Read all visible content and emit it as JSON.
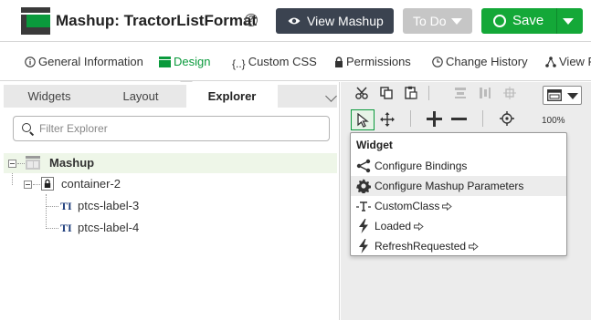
{
  "app": {
    "title": "Mashup: TractorListFormat"
  },
  "header": {
    "view_button": "View Mashup",
    "state_button": "To Do",
    "save_button": "Save"
  },
  "tabs": [
    {
      "label": "General Information"
    },
    {
      "label": "Design",
      "active": true
    },
    {
      "label": "Custom CSS"
    },
    {
      "label": "Permissions"
    },
    {
      "label": "Change History"
    },
    {
      "label": "View R"
    }
  ],
  "left_panel": {
    "subtabs": [
      "Widgets",
      "Layout",
      "Explorer"
    ],
    "active_subtab": "Explorer",
    "filter": {
      "placeholder": "Filter Explorer",
      "value": ""
    },
    "tree": [
      {
        "label": "Mashup",
        "selected": true
      },
      {
        "label": "container-2"
      },
      {
        "label": "ptcs-label-3"
      },
      {
        "label": "ptcs-label-4"
      }
    ]
  },
  "canvas": {
    "zoom": "100%"
  },
  "widget_menu": {
    "heading": "Widget",
    "items": [
      {
        "label": "Configure Bindings"
      },
      {
        "label": "Configure Mashup Parameters",
        "hovered": true
      },
      {
        "label": "CustomClass"
      },
      {
        "label": "Loaded"
      },
      {
        "label": "RefreshRequested"
      }
    ]
  },
  "colors": {
    "accent": "#0a9a3c",
    "save": "#14a838",
    "dark_button": "#3b4350"
  }
}
